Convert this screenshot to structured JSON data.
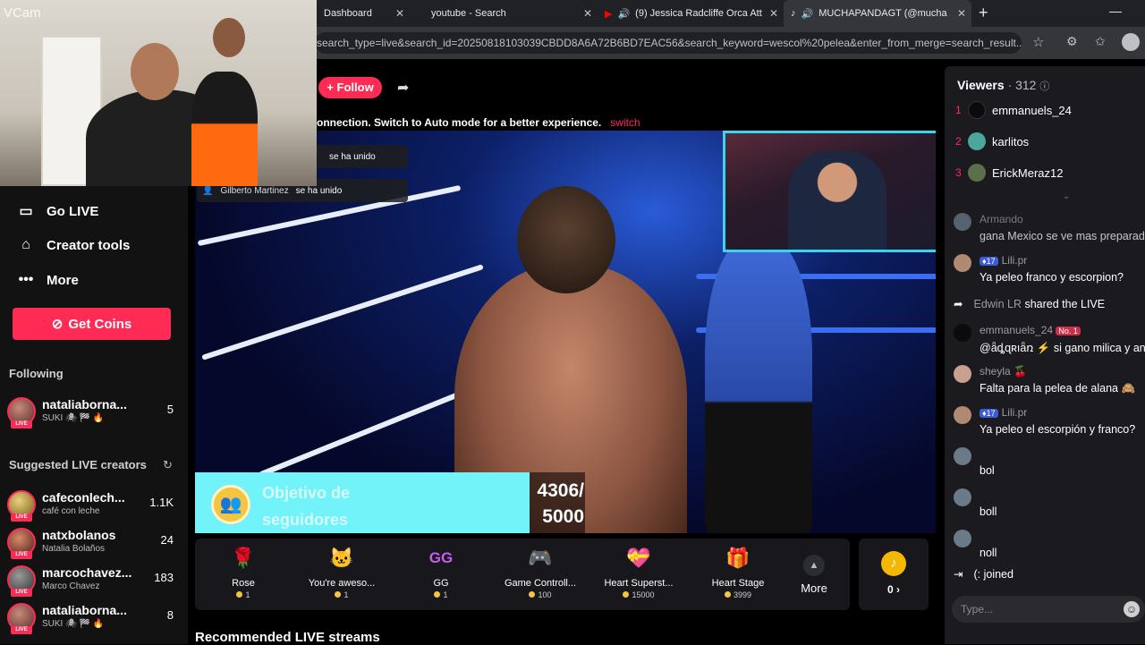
{
  "browser": {
    "tabs": [
      {
        "title": "Dashboard",
        "active": false
      },
      {
        "title": "youtube - Search",
        "active": false
      },
      {
        "title": "(9) Jessica Radcliffe Orca Att",
        "active": false
      },
      {
        "title": "MUCHAPANDAGT (@mucha",
        "active": true
      }
    ],
    "url": "search_type=live&search_id=20250818103039CBDD8A6A72B6BD7EAC56&search_keyword=wescol%20pelea&enter_from_merge=search_result..."
  },
  "webcam": {
    "label": "VCam"
  },
  "sidebar": {
    "nav": [
      {
        "label": "Go LIVE",
        "icon": "camera-icon"
      },
      {
        "label": "Creator tools",
        "icon": "home-icon"
      },
      {
        "label": "More",
        "icon": "dots-icon"
      }
    ],
    "get_coins": "Get Coins",
    "following_label": "Following",
    "following": [
      {
        "name": "nataliaborna...",
        "sub": "SUKI 🕷 🏁 🔥",
        "count": "5"
      }
    ],
    "suggested_label": "Suggested LIVE creators",
    "suggested": [
      {
        "name": "cafeconlech...",
        "sub": "café con leche",
        "count": "1.1K"
      },
      {
        "name": "natxbolanos",
        "sub": "Natalia Bolaños",
        "count": "24"
      },
      {
        "name": "marcochavez...",
        "sub": "Marco Chavez",
        "count": "183"
      },
      {
        "name": "nataliaborna...",
        "sub": "SUKI 🕷 🏁 🔥",
        "count": "8"
      }
    ]
  },
  "stream": {
    "follow_label": "+ Follow",
    "connection_msg": "onnection. Switch to Auto mode for a better experience.",
    "switch_label": "switch",
    "joins": [
      {
        "who": "",
        "text": "se ha unido"
      },
      {
        "who": "Gilberto Martinez",
        "text": "se ha unido"
      }
    ],
    "goal_label": "Objetivo de seguidores",
    "goal_count": "4306/ 5000",
    "recommended_label": "Recommended LIVE streams"
  },
  "gifts": [
    {
      "name": "Rose",
      "price": "1",
      "icon": "🌹"
    },
    {
      "name": "You're aweso...",
      "price": "1",
      "icon": "🐱"
    },
    {
      "name": "GG",
      "price": "1",
      "icon": "GG"
    },
    {
      "name": "Game Controll...",
      "price": "100",
      "icon": "🎮"
    },
    {
      "name": "Heart Superst...",
      "price": "15000",
      "icon": "💝"
    },
    {
      "name": "Heart Stage",
      "price": "3999",
      "icon": "🎁"
    }
  ],
  "more_label": "More",
  "coin_balance": "0 ›",
  "chat": {
    "viewers_label": "Viewers",
    "viewers_count": "· 312",
    "top_viewers": [
      {
        "rank": "1",
        "name": "emmanuels_24",
        "color": "#0b0b0b"
      },
      {
        "rank": "2",
        "name": "karlitos",
        "color": "#4aa79b"
      },
      {
        "rank": "3",
        "name": "ErickMeraz12",
        "color": "#5a6f4a"
      }
    ],
    "messages": [
      {
        "user": "Armando",
        "badge": "",
        "text": "gana Mexico se ve mas preparad"
      },
      {
        "user": "Lili.pr",
        "badge": "17",
        "text": "Ya peleo franco y escorpion?"
      },
      {
        "user": "emmanuels_24",
        "badge": "No. 1",
        "text": "@ǟȡɋʀıǟռ ⚡  si gano milica y ange"
      },
      {
        "user": "sheyla 🍒",
        "badge": "",
        "text": "Falta para la pelea de alana 🙈"
      },
      {
        "user": "Lili.pr",
        "badge": "17",
        "text": "Ya peleo el escorpión y franco?"
      }
    ],
    "shared_user": "Edwin LR",
    "shared_text": "shared the LIVE",
    "short_msgs": [
      "bol",
      "boll",
      "noll"
    ],
    "joined_text": "(:  joined",
    "input_placeholder": "Type..."
  }
}
